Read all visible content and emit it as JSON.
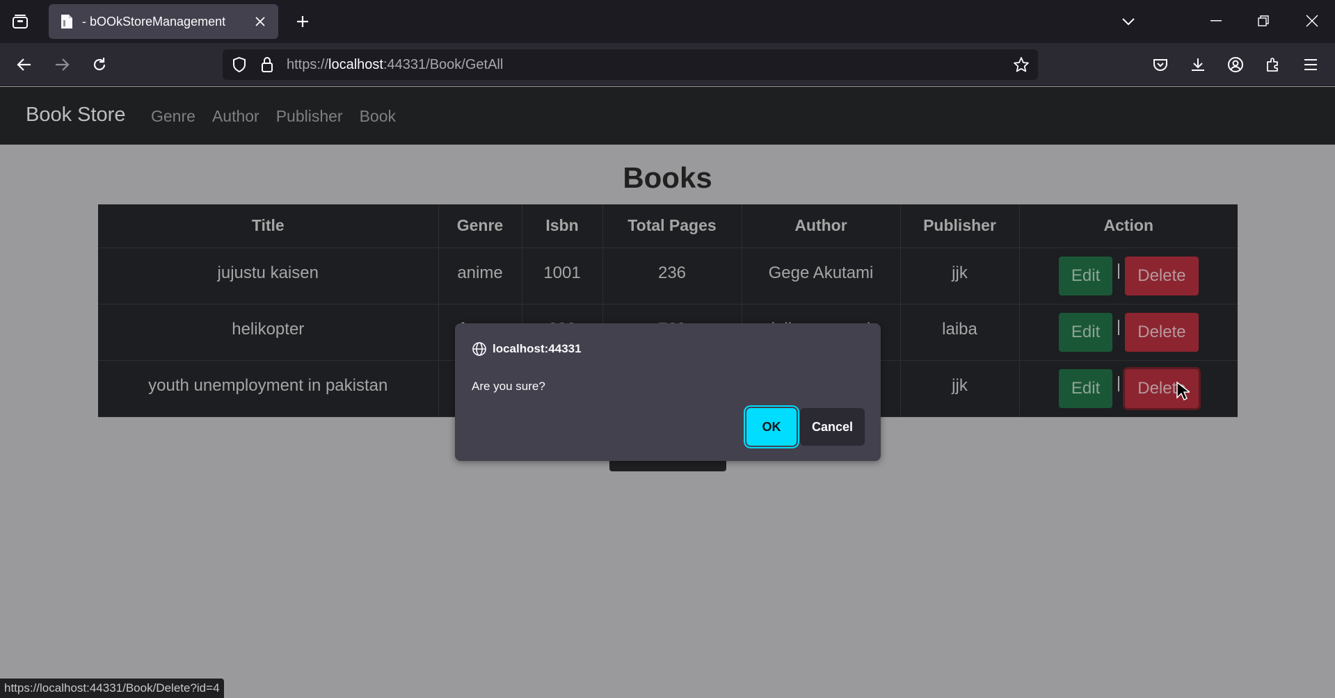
{
  "browser": {
    "tab_title": "- bOOkStoreManagement",
    "url_host": "localhost",
    "url_prefix": "https://",
    "url_suffix": ":44331/Book/GetAll"
  },
  "site": {
    "brand": "Book Store",
    "nav": [
      "Genre",
      "Author",
      "Publisher",
      "Book"
    ]
  },
  "page": {
    "title": "Books",
    "columns": [
      "Title",
      "Genre",
      "Isbn",
      "Total Pages",
      "Author",
      "Publisher",
      "Action"
    ],
    "rows": [
      {
        "title": "jujustu kaisen",
        "genre": "anime",
        "isbn": "1001",
        "pages": "236",
        "author": "Gege Akutami",
        "publisher": "jjk"
      },
      {
        "title": "helikopter",
        "genre": "funny",
        "isbn": "888",
        "pages": "760",
        "author": "laiba masood",
        "publisher": "laiba"
      },
      {
        "title": "youth unemployment in pakistan",
        "genre": "",
        "isbn": "",
        "pages": "",
        "author": "",
        "publisher": "jjk"
      }
    ],
    "edit_label": "Edit",
    "delete_label": "Delete"
  },
  "dialog": {
    "origin": "localhost:44331",
    "message": "Are you sure?",
    "ok_label": "OK",
    "cancel_label": "Cancel"
  },
  "status_bar": {
    "hover_url": "https://localhost:44331/Book/Delete?id=4"
  },
  "colors": {
    "edit_button": "#1a5737",
    "delete_button": "#8c2530",
    "ok_button": "#00ddff",
    "dialog_bg": "#42414d"
  }
}
